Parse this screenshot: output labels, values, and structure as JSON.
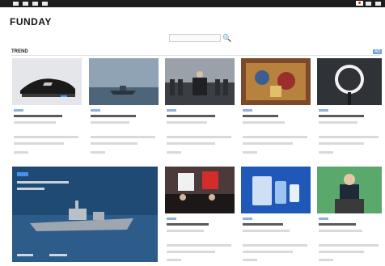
{
  "brand": {
    "logo": "FUNDAY"
  },
  "search": {
    "placeholder": "",
    "button_glyph": "🔍"
  },
  "section": {
    "title": "TREND",
    "ad": "AD"
  },
  "colors": {
    "topbar": "#1d1d1d",
    "accent": "#4a8fe7",
    "tag": "#8fb2e6"
  },
  "row1": [
    {
      "icon": "sneaker-image-icon"
    },
    {
      "icon": "ship-image-icon"
    },
    {
      "icon": "press-conference-image-icon"
    },
    {
      "icon": "painting-image-icon"
    },
    {
      "icon": "ring-light-image-icon"
    }
  ],
  "feature": {
    "icon": "warship-image-icon"
  },
  "row2": [
    {
      "icon": "protest-image-icon"
    },
    {
      "icon": "phone-image-icon"
    },
    {
      "icon": "speaker-podium-image-icon"
    }
  ]
}
